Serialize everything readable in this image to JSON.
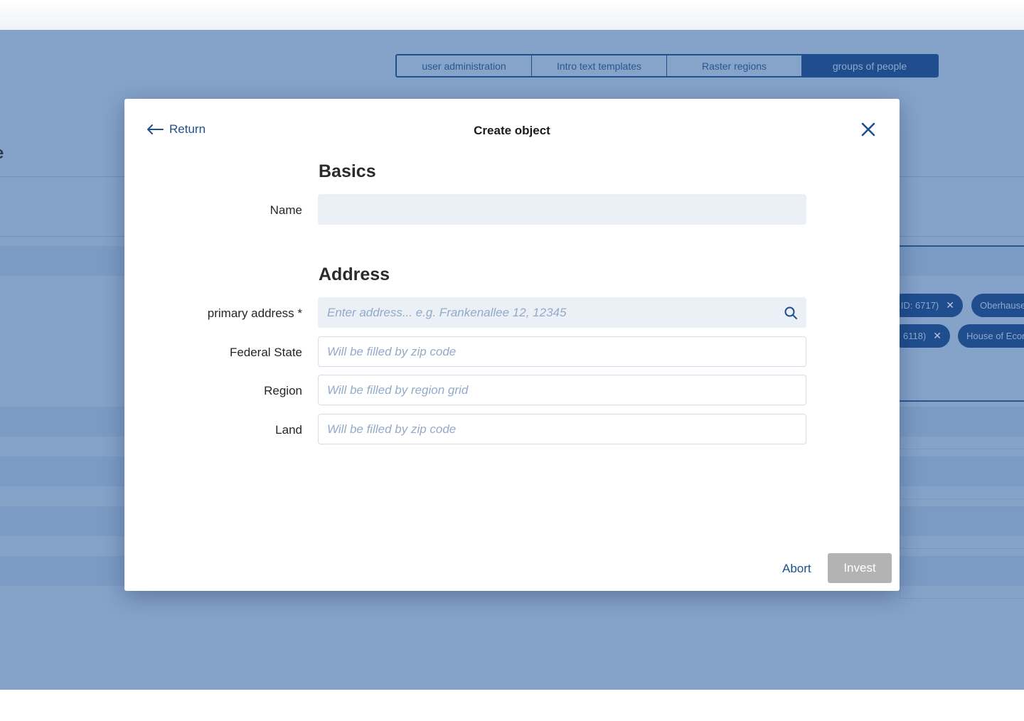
{
  "nav_tabs": [
    {
      "label": "user administration"
    },
    {
      "label": "Intro text templates"
    },
    {
      "label": "Raster regions"
    },
    {
      "label": "groups of people",
      "active": true
    }
  ],
  "background": {
    "title_fragment": "e",
    "chips": [
      {
        "label": "ID: 6717)"
      },
      {
        "label": "Oberhause"
      },
      {
        "label": "6118)"
      },
      {
        "label": "House of Ecor"
      }
    ]
  },
  "modal": {
    "return_label": "Return",
    "title": "Create object",
    "sections": {
      "basics": "Basics",
      "address": "Address"
    },
    "fields": {
      "name": {
        "label": "Name",
        "value": "",
        "placeholder": ""
      },
      "primary_address": {
        "label": "primary address *",
        "value": "",
        "placeholder": "Enter address... e.g. Frankenallee 12, 12345"
      },
      "federal_state": {
        "label": "Federal State",
        "value": "",
        "placeholder": "Will be filled by zip code"
      },
      "region": {
        "label": "Region",
        "value": "",
        "placeholder": "Will be filled by region grid"
      },
      "land": {
        "label": "Land",
        "value": "",
        "placeholder": "Will be filled by zip code"
      }
    },
    "actions": {
      "abort": "Abort",
      "invest": "Invest"
    }
  },
  "colors": {
    "accent": "#1f4f8f",
    "overlay": "#85a2c9",
    "disabled_button": "#b3b3b3",
    "input_fill": "#ebf0f6"
  }
}
